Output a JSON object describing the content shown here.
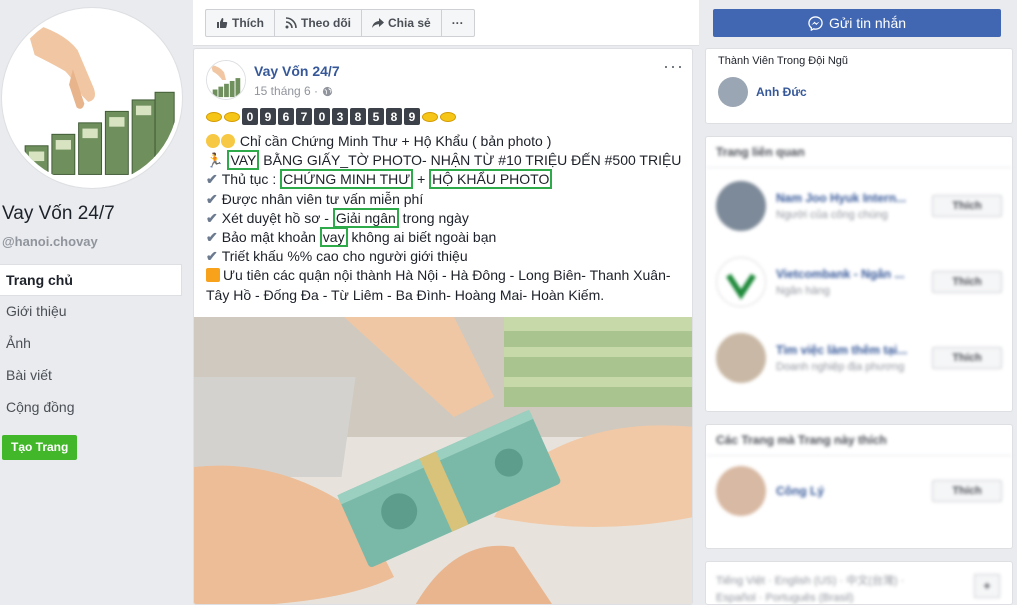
{
  "page": {
    "name": "Vay Vốn 24/7",
    "handle": "@hanoi.chovay"
  },
  "nav": [
    {
      "label": "Trang chủ"
    },
    {
      "label": "Giới thiệu"
    },
    {
      "label": "Ảnh"
    },
    {
      "label": "Bài viết"
    },
    {
      "label": "Cộng đồng"
    }
  ],
  "create_page_label": "Tạo Trang",
  "toolbar": {
    "like_label": "Thích",
    "follow_label": "Theo dõi",
    "share_label": "Chia sẻ",
    "more_label": "···"
  },
  "message_button_label": "Gửi tin nhắn",
  "post": {
    "author": "Vay Vốn 24/7",
    "time": "15 tháng 6 ·",
    "more": "···",
    "phone_digits": [
      "0",
      "9",
      "6",
      "7",
      "0",
      "3",
      "8",
      "5",
      "8",
      "9"
    ],
    "lines": {
      "l1": "Chỉ cần Chứng Minh Thư + Hộ Khẩu ( bản photo )",
      "l2a": "VAY",
      "l2b": " BẰNG GIẤY_TỜ PHOTO- NHẬN TỪ #10 TRIỆU ĐẾN #500 TRIỆU",
      "l3a": "Thủ tục : ",
      "l3b": "CHỨNG MINH THƯ",
      "l3c": " + ",
      "l3d": "HỘ KHẨU PHOTO",
      "l4": "Được nhân viên tư vấn miễn phí",
      "l5a": "Xét duyệt hồ sơ - ",
      "l5b": "Giải ngân",
      "l5c": " trong ngày",
      "l6a": "Bảo mật khoản ",
      "l6b": "vay",
      "l6c": " không ai biết ngoài bạn",
      "l7": "Triết khấu %% cao cho người giới thiệu",
      "l8": "Ưu tiên các quận nội thành Hà Nội - Hà Đông - Long Biên- Thanh Xuân-",
      "l9": "Tây Hồ - Đống Đa - Từ Liêm - Ba Đình- Hoàng Mai- Hoàn Kiếm."
    }
  },
  "team": {
    "title": "Thành Viên Trong Đội Ngũ",
    "member_name": "Anh Đức"
  },
  "related": {
    "title": "Trang liên quan",
    "items": [
      {
        "name": "Nam Joo Hyuk Intern...",
        "sub": "Người của công chúng",
        "like": "Thích"
      },
      {
        "name": "Vietcombank - Ngân ...",
        "sub": "Ngân hàng",
        "like": "Thích"
      },
      {
        "name": "Tìm việc làm thêm tại...",
        "sub": "Doanh nghiệp địa phương",
        "like": "Thích"
      }
    ]
  },
  "liked_by_page": {
    "title": "Các Trang mà Trang này thích",
    "items": [
      {
        "name": "Công Lý",
        "like": "Thích"
      }
    ]
  },
  "languages": {
    "line1": "Tiếng Việt · English (US) · 中文(台灣) ·",
    "line2": "Español · Português (Brasil)",
    "plus": "+"
  },
  "colors": {
    "facebook_blue": "#4267b2",
    "link_blue": "#365899",
    "green": "#42b72a",
    "highlight_green": "#2eaa4a"
  }
}
